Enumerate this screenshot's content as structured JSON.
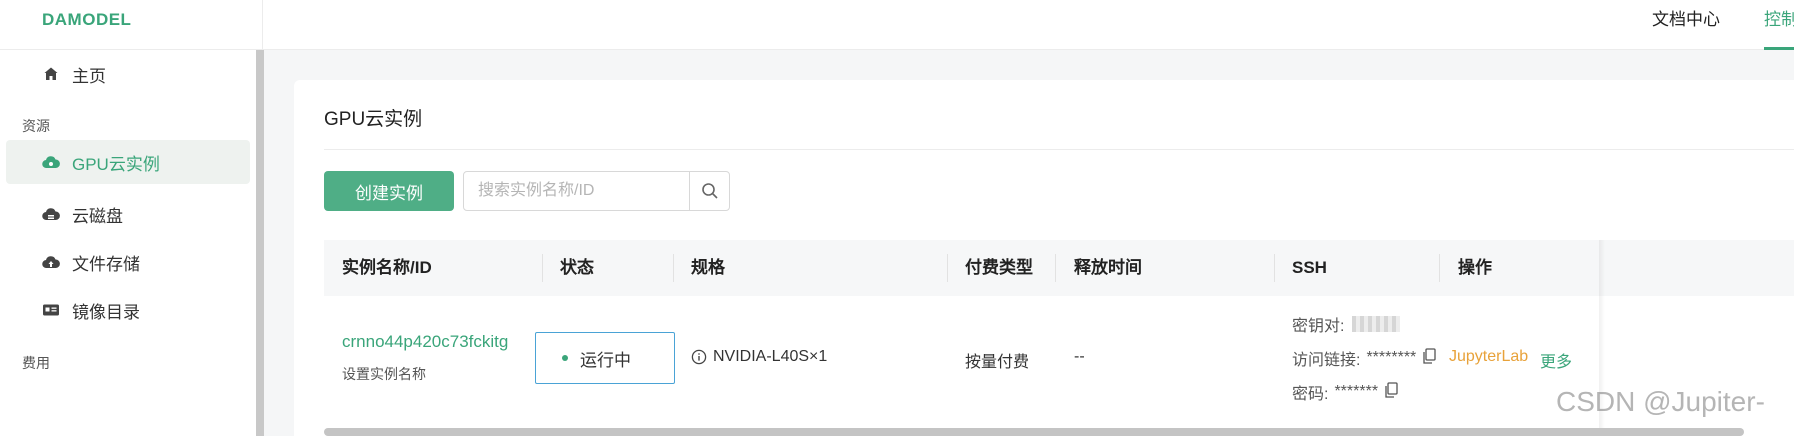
{
  "brand": {
    "logo": "DAMODEL",
    "accent": "#3aa57a"
  },
  "top_nav": [
    {
      "label": "文档中心",
      "active": false
    },
    {
      "label": "控制台",
      "active": true
    }
  ],
  "sidebar": {
    "home": {
      "label": "主页",
      "icon": "home-icon"
    },
    "section_resources": "资源",
    "items": [
      {
        "label": "GPU云实例",
        "icon": "cloud-gear-icon",
        "active": true
      },
      {
        "label": "云磁盘",
        "icon": "cloud-disk-icon"
      },
      {
        "label": "文件存储",
        "icon": "cloud-upload-icon"
      },
      {
        "label": "镜像目录",
        "icon": "image-catalog-icon"
      }
    ],
    "section_billing": "费用"
  },
  "page": {
    "title": "GPU云实例",
    "create_button": "创建实例",
    "search_placeholder": "搜索实例名称/ID"
  },
  "table": {
    "columns": [
      "实例名称/ID",
      "状态",
      "规格",
      "付费类型",
      "释放时间",
      "SSH",
      "操作"
    ],
    "rows": [
      {
        "id": "crnno44p420c73fckitg",
        "set_name": "设置实例名称",
        "status": "运行中",
        "spec": "NVIDIA-L40S×1",
        "pay_type": "按量付费",
        "release_time": "--",
        "ssh_key_label": "密钥对:",
        "ssh_link_label": "访问链接:",
        "ssh_link_value": "********",
        "ssh_pwd_label": "密码:",
        "ssh_pwd_value": "*******",
        "op_jupyter": "JupyterLab",
        "op_more": "更多"
      }
    ]
  },
  "watermark": "CSDN @Jupiter-"
}
